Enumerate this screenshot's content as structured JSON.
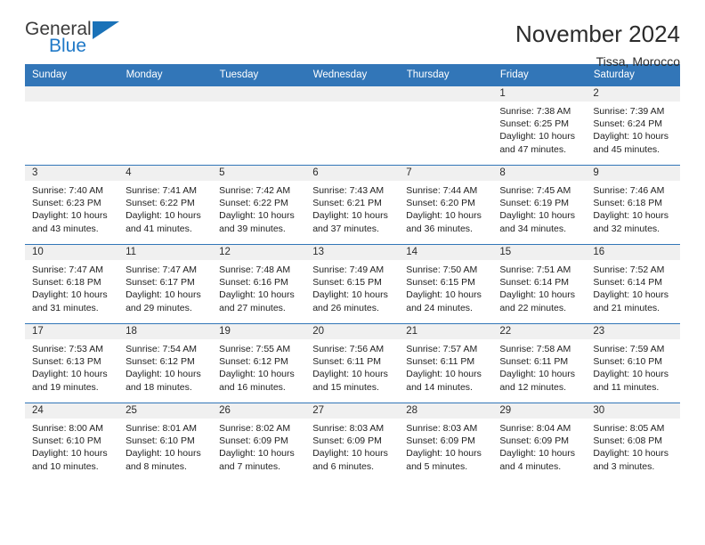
{
  "brand": {
    "name_top": "General",
    "name_bottom": "Blue",
    "color_primary": "#2079c7",
    "color_dark": "#3b3b3b"
  },
  "header": {
    "title": "November 2024",
    "location": "Tissa, Morocco"
  },
  "theme": {
    "header_bg": "#3276b8",
    "daynum_bg": "#f0f0f0",
    "cell_bg": "#ffffff",
    "text": "#222222"
  },
  "weekdays": [
    "Sunday",
    "Monday",
    "Tuesday",
    "Wednesday",
    "Thursday",
    "Friday",
    "Saturday"
  ],
  "weeks": [
    [
      {
        "day": "",
        "sunrise": "",
        "sunset": "",
        "daylight": "",
        "empty": true
      },
      {
        "day": "",
        "sunrise": "",
        "sunset": "",
        "daylight": "",
        "empty": true
      },
      {
        "day": "",
        "sunrise": "",
        "sunset": "",
        "daylight": "",
        "empty": true
      },
      {
        "day": "",
        "sunrise": "",
        "sunset": "",
        "daylight": "",
        "empty": true
      },
      {
        "day": "",
        "sunrise": "",
        "sunset": "",
        "daylight": "",
        "empty": true
      },
      {
        "day": "1",
        "sunrise": "Sunrise: 7:38 AM",
        "sunset": "Sunset: 6:25 PM",
        "daylight": "Daylight: 10 hours and 47 minutes.",
        "empty": false
      },
      {
        "day": "2",
        "sunrise": "Sunrise: 7:39 AM",
        "sunset": "Sunset: 6:24 PM",
        "daylight": "Daylight: 10 hours and 45 minutes.",
        "empty": false
      }
    ],
    [
      {
        "day": "3",
        "sunrise": "Sunrise: 7:40 AM",
        "sunset": "Sunset: 6:23 PM",
        "daylight": "Daylight: 10 hours and 43 minutes.",
        "empty": false
      },
      {
        "day": "4",
        "sunrise": "Sunrise: 7:41 AM",
        "sunset": "Sunset: 6:22 PM",
        "daylight": "Daylight: 10 hours and 41 minutes.",
        "empty": false
      },
      {
        "day": "5",
        "sunrise": "Sunrise: 7:42 AM",
        "sunset": "Sunset: 6:22 PM",
        "daylight": "Daylight: 10 hours and 39 minutes.",
        "empty": false
      },
      {
        "day": "6",
        "sunrise": "Sunrise: 7:43 AM",
        "sunset": "Sunset: 6:21 PM",
        "daylight": "Daylight: 10 hours and 37 minutes.",
        "empty": false
      },
      {
        "day": "7",
        "sunrise": "Sunrise: 7:44 AM",
        "sunset": "Sunset: 6:20 PM",
        "daylight": "Daylight: 10 hours and 36 minutes.",
        "empty": false
      },
      {
        "day": "8",
        "sunrise": "Sunrise: 7:45 AM",
        "sunset": "Sunset: 6:19 PM",
        "daylight": "Daylight: 10 hours and 34 minutes.",
        "empty": false
      },
      {
        "day": "9",
        "sunrise": "Sunrise: 7:46 AM",
        "sunset": "Sunset: 6:18 PM",
        "daylight": "Daylight: 10 hours and 32 minutes.",
        "empty": false
      }
    ],
    [
      {
        "day": "10",
        "sunrise": "Sunrise: 7:47 AM",
        "sunset": "Sunset: 6:18 PM",
        "daylight": "Daylight: 10 hours and 31 minutes.",
        "empty": false
      },
      {
        "day": "11",
        "sunrise": "Sunrise: 7:47 AM",
        "sunset": "Sunset: 6:17 PM",
        "daylight": "Daylight: 10 hours and 29 minutes.",
        "empty": false
      },
      {
        "day": "12",
        "sunrise": "Sunrise: 7:48 AM",
        "sunset": "Sunset: 6:16 PM",
        "daylight": "Daylight: 10 hours and 27 minutes.",
        "empty": false
      },
      {
        "day": "13",
        "sunrise": "Sunrise: 7:49 AM",
        "sunset": "Sunset: 6:15 PM",
        "daylight": "Daylight: 10 hours and 26 minutes.",
        "empty": false
      },
      {
        "day": "14",
        "sunrise": "Sunrise: 7:50 AM",
        "sunset": "Sunset: 6:15 PM",
        "daylight": "Daylight: 10 hours and 24 minutes.",
        "empty": false
      },
      {
        "day": "15",
        "sunrise": "Sunrise: 7:51 AM",
        "sunset": "Sunset: 6:14 PM",
        "daylight": "Daylight: 10 hours and 22 minutes.",
        "empty": false
      },
      {
        "day": "16",
        "sunrise": "Sunrise: 7:52 AM",
        "sunset": "Sunset: 6:14 PM",
        "daylight": "Daylight: 10 hours and 21 minutes.",
        "empty": false
      }
    ],
    [
      {
        "day": "17",
        "sunrise": "Sunrise: 7:53 AM",
        "sunset": "Sunset: 6:13 PM",
        "daylight": "Daylight: 10 hours and 19 minutes.",
        "empty": false
      },
      {
        "day": "18",
        "sunrise": "Sunrise: 7:54 AM",
        "sunset": "Sunset: 6:12 PM",
        "daylight": "Daylight: 10 hours and 18 minutes.",
        "empty": false
      },
      {
        "day": "19",
        "sunrise": "Sunrise: 7:55 AM",
        "sunset": "Sunset: 6:12 PM",
        "daylight": "Daylight: 10 hours and 16 minutes.",
        "empty": false
      },
      {
        "day": "20",
        "sunrise": "Sunrise: 7:56 AM",
        "sunset": "Sunset: 6:11 PM",
        "daylight": "Daylight: 10 hours and 15 minutes.",
        "empty": false
      },
      {
        "day": "21",
        "sunrise": "Sunrise: 7:57 AM",
        "sunset": "Sunset: 6:11 PM",
        "daylight": "Daylight: 10 hours and 14 minutes.",
        "empty": false
      },
      {
        "day": "22",
        "sunrise": "Sunrise: 7:58 AM",
        "sunset": "Sunset: 6:11 PM",
        "daylight": "Daylight: 10 hours and 12 minutes.",
        "empty": false
      },
      {
        "day": "23",
        "sunrise": "Sunrise: 7:59 AM",
        "sunset": "Sunset: 6:10 PM",
        "daylight": "Daylight: 10 hours and 11 minutes.",
        "empty": false
      }
    ],
    [
      {
        "day": "24",
        "sunrise": "Sunrise: 8:00 AM",
        "sunset": "Sunset: 6:10 PM",
        "daylight": "Daylight: 10 hours and 10 minutes.",
        "empty": false
      },
      {
        "day": "25",
        "sunrise": "Sunrise: 8:01 AM",
        "sunset": "Sunset: 6:10 PM",
        "daylight": "Daylight: 10 hours and 8 minutes.",
        "empty": false
      },
      {
        "day": "26",
        "sunrise": "Sunrise: 8:02 AM",
        "sunset": "Sunset: 6:09 PM",
        "daylight": "Daylight: 10 hours and 7 minutes.",
        "empty": false
      },
      {
        "day": "27",
        "sunrise": "Sunrise: 8:03 AM",
        "sunset": "Sunset: 6:09 PM",
        "daylight": "Daylight: 10 hours and 6 minutes.",
        "empty": false
      },
      {
        "day": "28",
        "sunrise": "Sunrise: 8:03 AM",
        "sunset": "Sunset: 6:09 PM",
        "daylight": "Daylight: 10 hours and 5 minutes.",
        "empty": false
      },
      {
        "day": "29",
        "sunrise": "Sunrise: 8:04 AM",
        "sunset": "Sunset: 6:09 PM",
        "daylight": "Daylight: 10 hours and 4 minutes.",
        "empty": false
      },
      {
        "day": "30",
        "sunrise": "Sunrise: 8:05 AM",
        "sunset": "Sunset: 6:08 PM",
        "daylight": "Daylight: 10 hours and 3 minutes.",
        "empty": false
      }
    ]
  ]
}
